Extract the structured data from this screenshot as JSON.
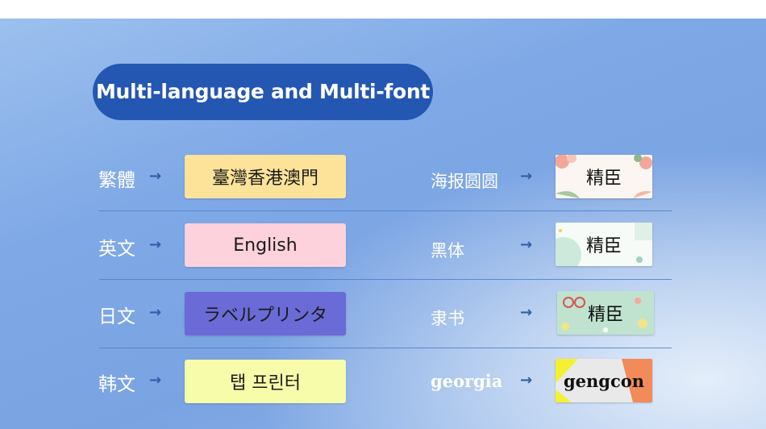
{
  "title": "Multi-language and Multi-font",
  "arrow_glyph": "→",
  "languages": [
    {
      "label": "繁體",
      "sample": "臺灣香港澳門",
      "color": "#fde39a"
    },
    {
      "label": "英文",
      "sample": "English",
      "color": "#fdd2dc"
    },
    {
      "label": "日文",
      "sample": "ラベルプリンタ",
      "color": "#6a6bd6"
    },
    {
      "label": "韩文",
      "sample": "탭 프린터",
      "color": "#f6fcaa"
    }
  ],
  "fonts": [
    {
      "label": "海报圆圆",
      "sample": "精臣"
    },
    {
      "label": "黑体",
      "sample": "精臣"
    },
    {
      "label": "隶书",
      "sample": "精臣"
    },
    {
      "label": "georgia",
      "sample": "gengcon"
    }
  ]
}
